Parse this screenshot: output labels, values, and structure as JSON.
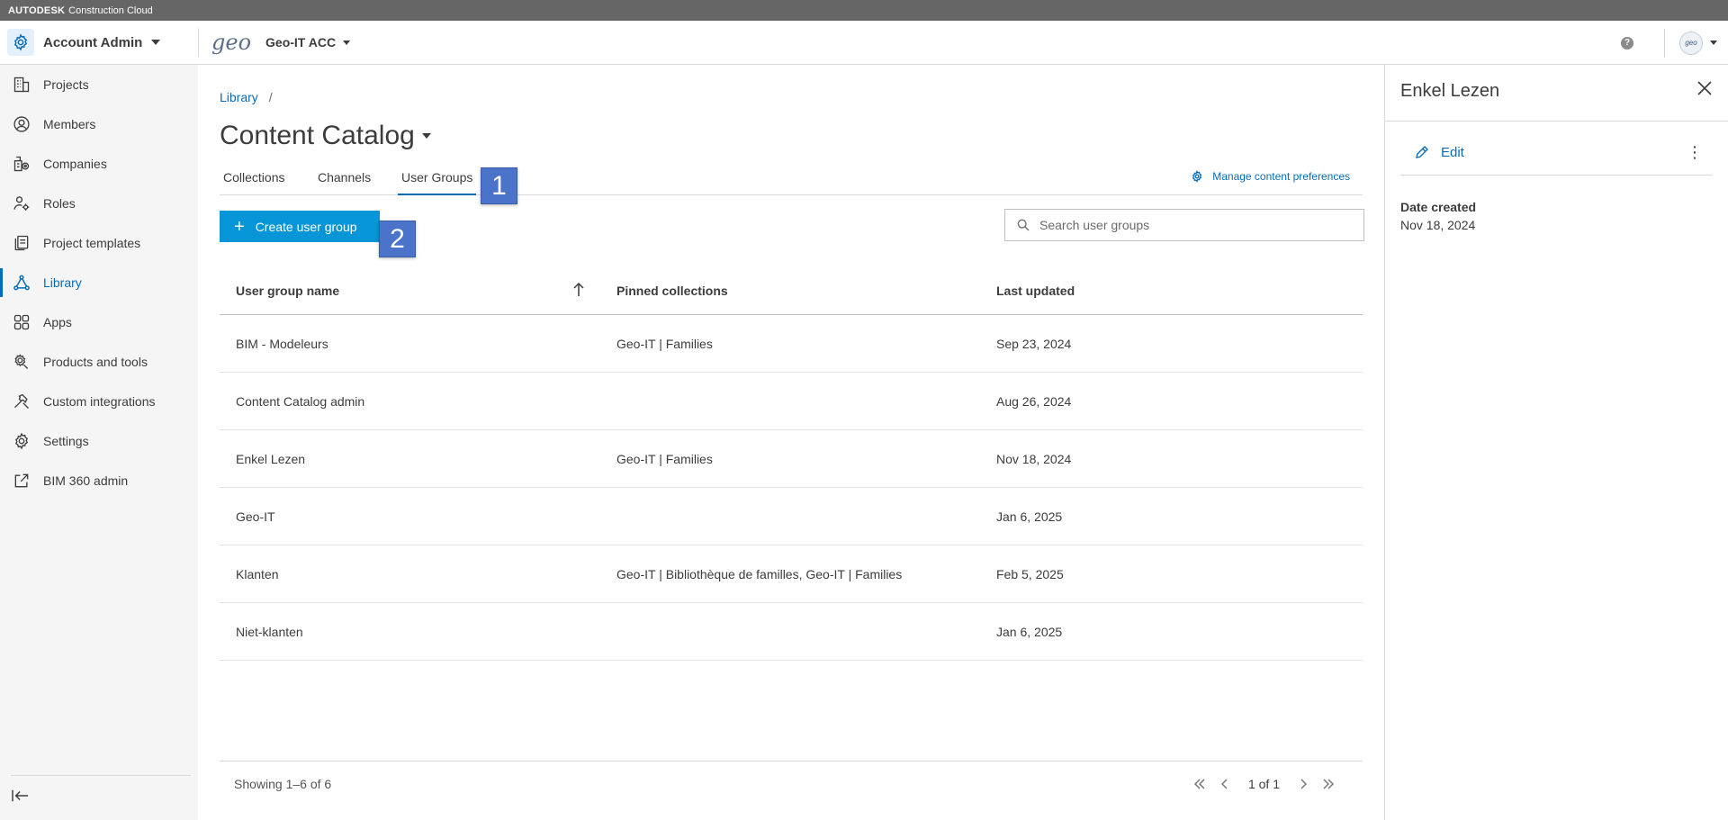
{
  "topstrip": {
    "brand": "AUTODESK",
    "product": "Construction Cloud"
  },
  "header": {
    "account_title": "Account Admin",
    "logo_text": "geo",
    "project_name": "Geo-IT ACC",
    "help_glyph": "?",
    "avatar_text": "geo"
  },
  "sidebar": {
    "items": [
      {
        "label": "Projects",
        "icon": "building-icon"
      },
      {
        "label": "Members",
        "icon": "user-circle-icon"
      },
      {
        "label": "Companies",
        "icon": "company-icon"
      },
      {
        "label": "Roles",
        "icon": "user-gear-icon"
      },
      {
        "label": "Project templates",
        "icon": "template-icon"
      },
      {
        "label": "Library",
        "icon": "library-icon",
        "active": true
      },
      {
        "label": "Apps",
        "icon": "apps-grid-icon"
      },
      {
        "label": "Products and tools",
        "icon": "gear-tools-icon"
      },
      {
        "label": "Custom integrations",
        "icon": "hammer-icon"
      },
      {
        "label": "Settings",
        "icon": "gear-icon"
      },
      {
        "label": "BIM 360 admin",
        "icon": "external-link-icon"
      }
    ]
  },
  "main": {
    "breadcrumb": {
      "link": "Library",
      "separator": "/"
    },
    "title": "Content Catalog",
    "tabs": [
      {
        "label": "Collections"
      },
      {
        "label": "Channels"
      },
      {
        "label": "User Groups",
        "active": true
      }
    ],
    "manage_link": "Manage content preferences",
    "create_button": "Create user group",
    "search_placeholder": "Search user groups",
    "badges": [
      "1",
      "2"
    ],
    "table": {
      "columns": [
        "User group name",
        "Pinned collections",
        "Last updated"
      ],
      "rows": [
        {
          "name": "BIM - Modeleurs",
          "pinned": "Geo-IT | Families",
          "updated": "Sep 23, 2024"
        },
        {
          "name": "Content Catalog admin",
          "pinned": "",
          "updated": "Aug 26, 2024"
        },
        {
          "name": "Enkel Lezen",
          "pinned": "Geo-IT | Families",
          "updated": "Nov 18, 2024"
        },
        {
          "name": "Geo-IT",
          "pinned": "",
          "updated": "Jan 6, 2025"
        },
        {
          "name": "Klanten",
          "pinned": "Geo-IT | Bibliothèque de familles, Geo-IT | Families",
          "updated": "Feb 5, 2025"
        },
        {
          "name": "Niet-klanten",
          "pinned": "",
          "updated": "Jan 6, 2025"
        }
      ]
    },
    "footer": {
      "showing": "Showing 1–6 of 6",
      "page": "1 of 1"
    }
  },
  "panel": {
    "title": "Enkel Lezen",
    "edit_label": "Edit",
    "date_created_label": "Date created",
    "date_created_value": "Nov 18, 2024"
  },
  "colors": {
    "accent": "#0a6cb5",
    "button": "#0696d7",
    "badge": "#4a73c9",
    "topstrip": "#666666",
    "sidebar": "#f5f5f5"
  }
}
